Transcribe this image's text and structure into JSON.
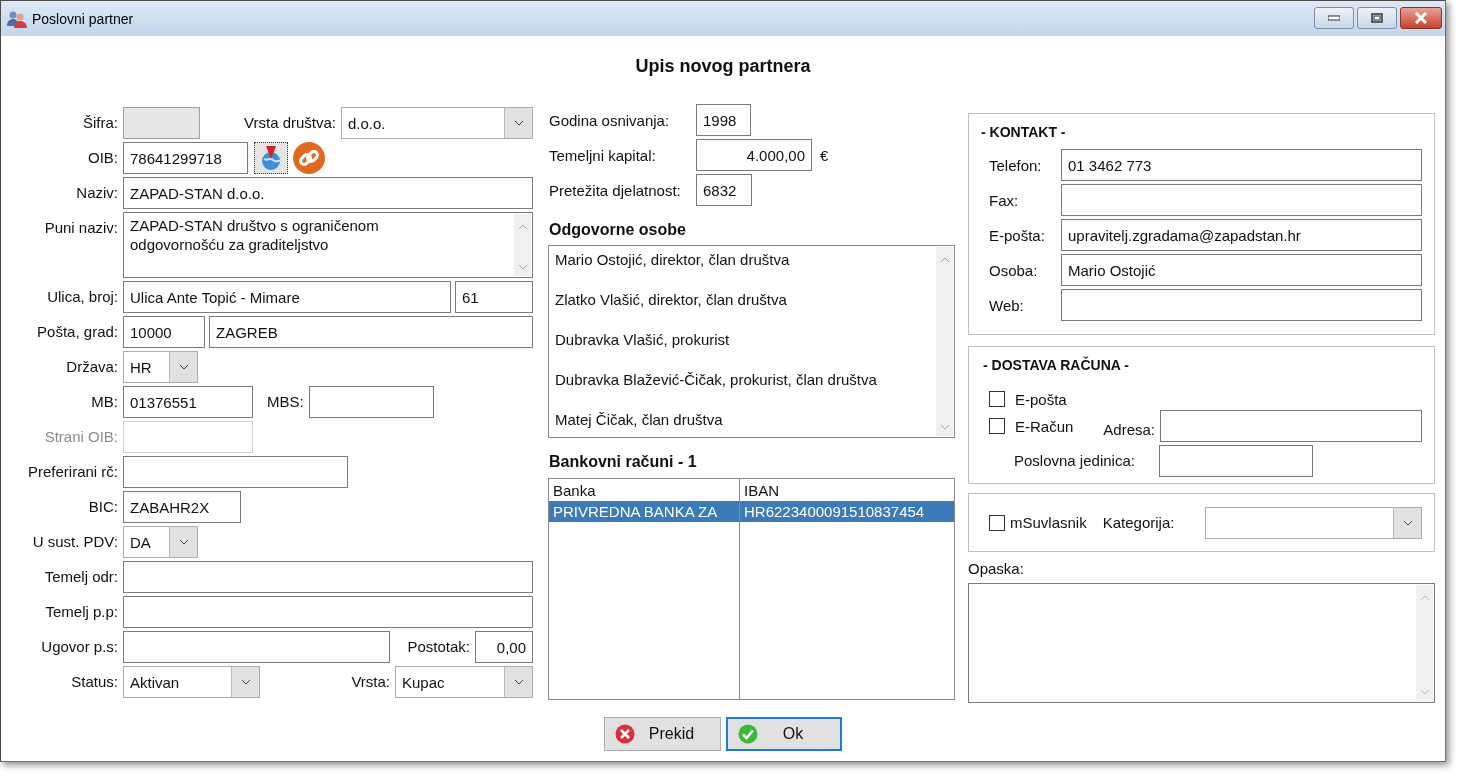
{
  "window": {
    "title": "Poslovni partner"
  },
  "heading": "Upis novog partnera",
  "general": {
    "sifra": {
      "label": "Šifra:",
      "readonly": true
    },
    "vrsta_drustva": {
      "label": "Vrsta društva:",
      "value": "d.o.o."
    },
    "oib": {
      "label": "OIB:",
      "value": "78641299718"
    },
    "naziv": {
      "label": "Naziv:",
      "value": "ZAPAD-STAN d.o.o."
    },
    "puni_naziv": {
      "label": "Puni naziv:",
      "lines": [
        "ZAPAD-STAN društvo s ograničenom",
        "odgovornošću za graditeljstvo"
      ]
    },
    "ulica_broj": {
      "label": "Ulica, broj:",
      "street": "Ulica Ante Topić - Mimare",
      "number": "61"
    },
    "posta_grad": {
      "label": "Pošta, grad:",
      "postcode": "10000",
      "city": "ZAGREB"
    },
    "drzava": {
      "label": "Država:",
      "value": "HR"
    },
    "mb": {
      "label": "MB:",
      "value": "01376551"
    },
    "mbs": {
      "label": "MBS:"
    },
    "strani_oib": {
      "label": "Strani OIB:",
      "disabled": true
    },
    "preferirani_rc": {
      "label": "Preferirani rč:"
    },
    "bic": {
      "label": "BIC:",
      "value": "ZABAHR2X"
    },
    "u_sust_pdv": {
      "label": "U sust. PDV:",
      "value": "DA"
    },
    "temelj_odr": {
      "label": "Temelj odr:"
    },
    "temelj_pp": {
      "label": "Temelj p.p:"
    },
    "ugovor_ps": {
      "label": "Ugovor p.s:"
    },
    "postotak": {
      "label": "Postotak:",
      "value": "0,00"
    },
    "status": {
      "label": "Status:",
      "value": "Aktivan"
    },
    "vrsta": {
      "label": "Vrsta:",
      "value": "Kupac"
    }
  },
  "company": {
    "godina": {
      "label": "Godina osnivanja:",
      "value": "1998"
    },
    "kapital": {
      "label": "Temeljni kapital:",
      "value": "4.000,00",
      "unit": "€"
    },
    "djelatnost": {
      "label": "Pretežita djelatnost:",
      "value": "6832"
    }
  },
  "responsible_persons": {
    "title": "Odgovorne osobe",
    "items": [
      "Mario Ostojić, direktor, član društva",
      "Zlatko Vlašić, direktor, član društva",
      "Dubravka Vlašić, prokurist",
      "Dubravka Blažević-Čičak, prokurist, član društva",
      "Matej Čičak, član društva"
    ]
  },
  "bank_accounts": {
    "title": "Bankovni računi - 1",
    "columns": [
      "Banka",
      "IBAN"
    ],
    "rows": [
      {
        "cells": [
          "PRIVREDNA BANKA ZA",
          "HR6223400091510837454"
        ],
        "selected": true
      }
    ]
  },
  "buttons": [
    {
      "kind": "cancel",
      "label": "Prekid",
      "focused": false
    },
    {
      "kind": "ok",
      "label": "Ok",
      "focused": true
    }
  ],
  "contact": {
    "title": "- KONTAKT -",
    "fields": [
      {
        "label": "Telefon:",
        "value": "01 3462 773"
      },
      {
        "label": "Fax:"
      },
      {
        "label": "E-pošta:",
        "value": "upravitelj.zgradama@zapadstan.hr"
      },
      {
        "label": "Osoba:",
        "value": "Mario Ostojić"
      },
      {
        "label": "Web:"
      }
    ]
  },
  "invoice_delivery": {
    "title": "- DOSTAVA RAČUNA -",
    "options": [
      {
        "label": "E-pošta",
        "checked": false
      },
      {
        "label": "E-Račun",
        "checked": false
      }
    ],
    "address": {
      "label": "Adresa:"
    },
    "business_unit": {
      "label": "Poslovna jedinica:"
    }
  },
  "co_owner": {
    "label": "mSuvlasnik",
    "checked": false
  },
  "category": {
    "label": "Kategorija:"
  },
  "note": {
    "label": "Opaska:"
  }
}
